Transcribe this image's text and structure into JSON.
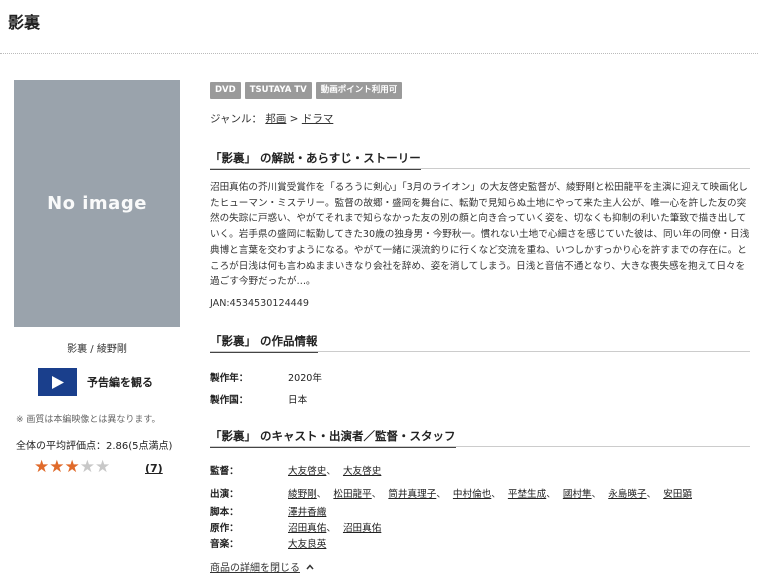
{
  "page": {
    "title": "影裏"
  },
  "poster": {
    "placeholder": "No image",
    "caption": "影裏 / 綾野剛"
  },
  "trailer": {
    "label": "予告編を観る"
  },
  "note": "※ 画質は本編映像とは異なります。",
  "rating": {
    "summary": "全体の平均評価点：2.86(5点満点)",
    "stars": 2.86,
    "max": 5,
    "count": "(7)"
  },
  "badges": [
    "DVD",
    "TSUTAYA TV",
    "動画ポイント利用可"
  ],
  "genre": {
    "label": "ジャンル：",
    "main": "邦画",
    "sep": ">",
    "sub": "ドラマ"
  },
  "story": {
    "heading": "「影裏」 の解説・あらすじ・ストーリー",
    "text": "沼田真佑の芥川賞受賞作を「るろうに剣心」「3月のライオン」の大友啓史監督が、綾野剛と松田龍平を主演に迎えて映画化したヒューマン・ミステリー。監督の故郷・盛岡を舞台に、転勤で見知らぬ土地にやって来た主人公が、唯一心を許した友の突然の失踪に戸惑い、やがてそれまで知らなかった友の別の顔と向き合っていく姿を、切なくも抑制の利いた筆致で描き出していく。岩手県の盛岡に転勤してきた30歳の独身男・今野秋一。慣れない土地で心細さを感じていた彼は、同い年の同僚・日浅典博と言葉を交わすようになる。やがて一緒に渓流釣りに行くなど交流を重ね、いつしかすっかり心を許すまでの存在に。ところが日浅は何も言わぬままいきなり会社を辞め、姿を消してしまう。日浅と音信不通となり、大きな喪失感を抱えて日々を過ごす今野だったが…。",
    "jan": "JAN:4534530124449"
  },
  "work_info": {
    "heading": "「影裏」 の作品情報",
    "rows": [
      {
        "label": "製作年：",
        "value": "2020年"
      },
      {
        "label": "製作国：",
        "value": "日本"
      }
    ]
  },
  "cast": {
    "heading": "「影裏」 のキャスト・出演者／監督・スタッフ",
    "directors": {
      "label": "監督：",
      "names": [
        "大友啓史",
        "大友啓史"
      ]
    },
    "actors": {
      "label": "出演：",
      "names": [
        "綾野剛",
        "松田龍平",
        "筒井真理子",
        "中村倫也",
        "平埜生成",
        "國村隼",
        "永島暎子",
        "安田顕"
      ]
    },
    "writers": {
      "label": "脚本：",
      "names": [
        "澤井香織"
      ]
    },
    "original": {
      "label": "原作：",
      "names": [
        "沼田真佑",
        "沼田真佑"
      ]
    },
    "music": {
      "label": "音楽：",
      "names": [
        "大友良英"
      ]
    }
  },
  "toggle": {
    "label": "商品の詳細を閉じる"
  },
  "colors": {
    "accent_star": "#e06a2a",
    "trailer_blue": "#1a3f8c",
    "badge_gray": "#9a9a9a"
  }
}
